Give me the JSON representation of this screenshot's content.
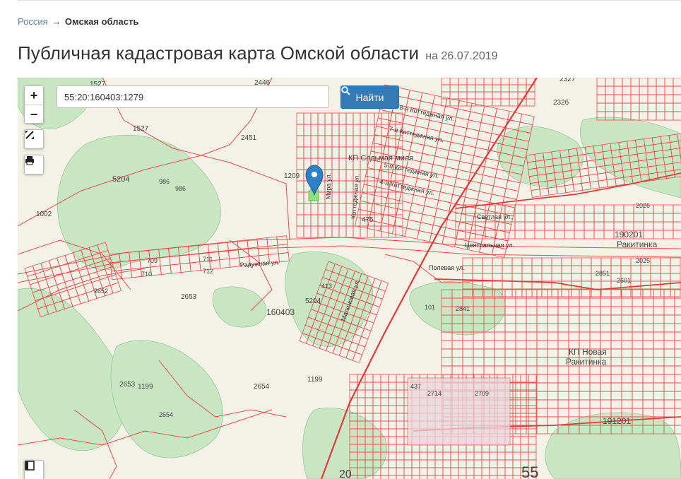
{
  "breadcrumb": {
    "root": "Россия",
    "arrow": "→",
    "current": "Омская область"
  },
  "page": {
    "title": "Публичная кадастровая карта Омской области",
    "date": "на 26.07.2019"
  },
  "search": {
    "value": "55:20:160403:1279",
    "button_label": "Найти"
  },
  "controls": {
    "zoom_in": "+",
    "zoom_out": "−"
  },
  "map": {
    "labels": [
      "1527",
      "2446",
      "2327",
      "2451",
      "1527",
      "2326",
      "5204",
      "986",
      "986",
      "1209",
      "КП Седьмая миля",
      "1002",
      "475",
      "190201",
      "Ракитинка",
      "2026",
      "2025",
      "2851",
      "2601",
      "709",
      "710",
      "711",
      "712",
      "413",
      "2652",
      "2653",
      "5204",
      "160403",
      "101",
      "2841",
      "КП Новая",
      "Ракитинка",
      "437",
      "2714",
      "2709",
      "191201",
      "2653",
      "1199",
      "2654",
      "1199",
      "2654",
      "20",
      "55"
    ],
    "streets": [
      "8-я Коттеджная ул.",
      "7-я Коттеджная ул.",
      "5-я Коттеджная ул.",
      "4-я Коттеджная ул.",
      "Светлая ул.",
      "Центральная ул.",
      "Полевая ул.",
      "Радужная ул.",
      "Малиновая ул.",
      "Мира ул.",
      "Коттеджная ул."
    ],
    "colors": {
      "parcel": "#e8504f",
      "forest": "#c9e6c2",
      "ground": "#f4f1e6",
      "marker": "#2e83c8",
      "selected": "#8fe07a"
    }
  }
}
